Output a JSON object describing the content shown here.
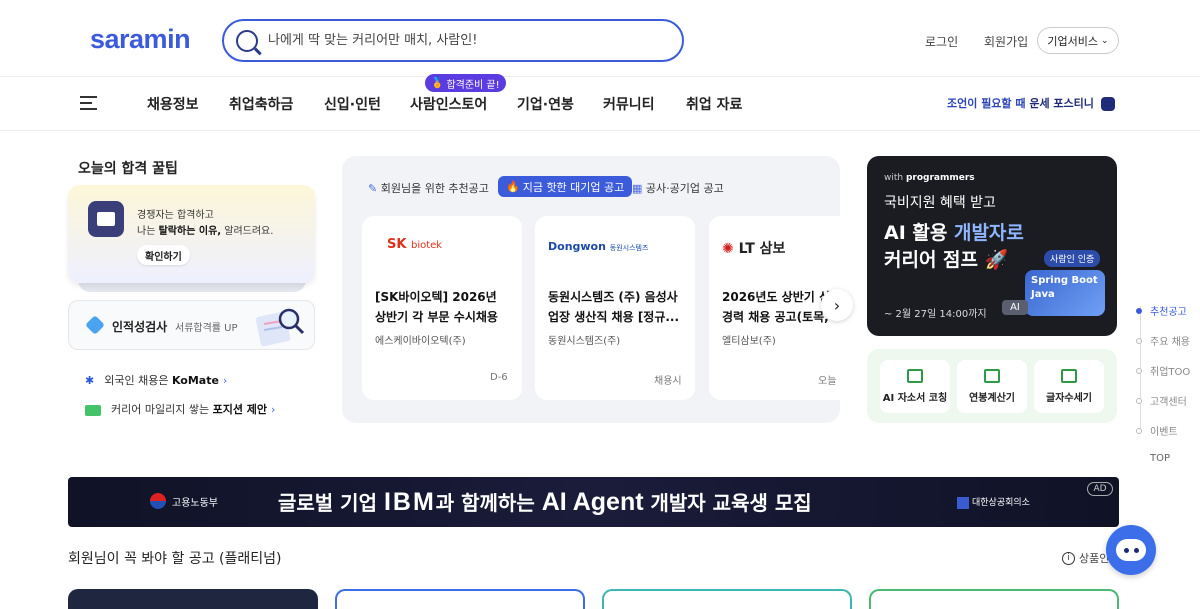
{
  "header": {
    "logo": "saramin",
    "search_placeholder": "나에게 딱 맞는 커리어만 매치, 사람인!",
    "login": "로그인",
    "signup": "회원가입",
    "business_services": "기업서비스"
  },
  "nav": {
    "items": [
      "채용정보",
      "취업축하금",
      "신입·인턴",
      "사람인스토어",
      "기업·연봉",
      "커뮤니티",
      "취업 자료"
    ],
    "badge": "합격준비 끝!",
    "right_text": "조언이 필요할 때",
    "right_bold": "운세 포스티니"
  },
  "tips": {
    "title": "오늘의 합격 꿀팁",
    "line1": "경쟁자는 합격하고",
    "line2_pre": "나는 ",
    "line2_bold": "탈락하는 이유,",
    "line2_post": " 알려드려요.",
    "button": "확인하기"
  },
  "aptitude": {
    "title": "인적성검사",
    "subtitle": "서류합격률 UP"
  },
  "links": [
    {
      "pre": "외국인 채용은 ",
      "bold": "KoMate"
    },
    {
      "pre": "커리어 마일리지 쌓는 ",
      "bold": "포지션 제안"
    }
  ],
  "recommend": {
    "tabs": [
      "회원님을 위한 추천공고",
      "지금 핫한 대기업 공고",
      "공사·공기업 공고"
    ],
    "cards": [
      {
        "logo": "SK biotek",
        "title_l1": "[SK바이오텍] 2026년",
        "title_l2": "상반기 각 부문 수시채용",
        "company": "에스케이바이오텍(주)",
        "dday": "D-6"
      },
      {
        "logo": "Dongwon 동원시스템즈",
        "title_l1": "동원시스템즈 (주) 음성사",
        "title_l2": "업장 생산직 채용 [정규...",
        "company": "동원시스템즈(주)",
        "dday": "채용시"
      },
      {
        "logo": "LT 삼보",
        "title_l1": "2026년도 상반기 신",
        "title_l2": "경력 채용 공고(토목,",
        "company": "엘티삼보(주)",
        "dday": "오늘"
      }
    ]
  },
  "ad_right": {
    "with": "with",
    "brand": "programmers",
    "line1": "국비지원 혜택 받고",
    "line2_a": "AI 활용 ",
    "line2_b": "개발자로",
    "line3": "커리어 점프",
    "cert": "사람인 인증",
    "spring": "Spring Boot",
    "java": "Java",
    "date": "~ 2월 27일 14:00까지",
    "ai_tag": "AI"
  },
  "tools": [
    "AI 자소서 코칭",
    "연봉계산기",
    "글자수세기"
  ],
  "side_nav": {
    "items": [
      "추천공고",
      "주요 채용",
      "취업TOO",
      "고객센터",
      "이벤트"
    ],
    "top": "TOP"
  },
  "wide_banner": {
    "gov": "고용노동부",
    "text_a": "글로벌 기업 ",
    "ibm": "IBM",
    "text_b": "과 함께하는 ",
    "ai_agent": "AI Agent",
    "text_c": " 개발자 교육생 모집",
    "org": "대한상공회의소",
    "ad": "AD"
  },
  "section": {
    "title": "회원님이 꼭 봐야 할 공고 (플래티넘)",
    "product_info": "상품인"
  },
  "colors": {
    "brand": "#3b5bdb",
    "nav_badge": "#5b3ce0",
    "tool_panel": "#eef8ee"
  }
}
